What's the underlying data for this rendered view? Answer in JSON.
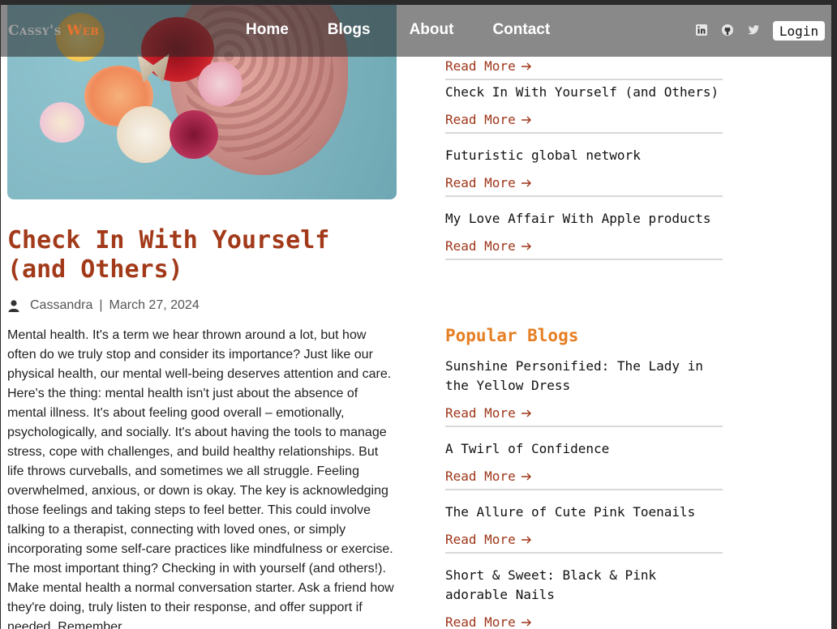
{
  "nav": {
    "logo_part1": "Cassy's",
    "logo_part2": "Web",
    "links": [
      "Home",
      "Blogs",
      "About",
      "Contact"
    ],
    "login": "Login",
    "icons": [
      "linkedin-icon",
      "github-icon",
      "twitter-icon"
    ]
  },
  "post": {
    "title": "Check In With Yourself (and Others)",
    "author": "Cassandra",
    "separator": "|",
    "date": "March 27, 2024",
    "body": "Mental health. It's a term we hear thrown around a lot, but how often do we truly stop and consider its importance? Just like our physical health, our mental well-being deserves attention and care. Here's the thing: mental health isn't just about the absence of mental illness. It's about feeling good overall – emotionally, psychologically, and socially. It's about having the tools to manage stress, cope with challenges, and build healthy relationships. But life throws curveballs, and sometimes we all struggle. Feeling overwhelmed, anxious, or down is okay. The key is acknowledging those feelings and taking steps to feel better. This could involve talking to a therapist, connecting with loved ones, or simply incorporating some self-care practices like mindfulness or exercise. The most important thing? Checking in with yourself (and others!). Make mental health a normal conversation starter. Ask a friend how they're doing, truly listen to their response, and offer support if needed. Remember,"
  },
  "recent": {
    "items": [
      {
        "title": "",
        "read_more": "Read More"
      },
      {
        "title": "Check In With Yourself (and Others)",
        "read_more": "Read More"
      },
      {
        "title": "Futuristic global network",
        "read_more": "Read More"
      },
      {
        "title": "My Love Affair With Apple products",
        "read_more": "Read More"
      }
    ]
  },
  "popular": {
    "heading": "Popular Blogs",
    "items": [
      {
        "title": "Sunshine Personified: The Lady in the Yellow Dress",
        "read_more": "Read More"
      },
      {
        "title": "A Twirl of Confidence",
        "read_more": "Read More"
      },
      {
        "title": "The Allure of Cute Pink Toenails",
        "read_more": "Read More"
      },
      {
        "title": "Short & Sweet: Black & Pink adorable Nails",
        "read_more": "Read More"
      }
    ]
  },
  "colors": {
    "accent": "#e67e22",
    "title": "#a23a1a",
    "read_more": "#9e3518"
  }
}
